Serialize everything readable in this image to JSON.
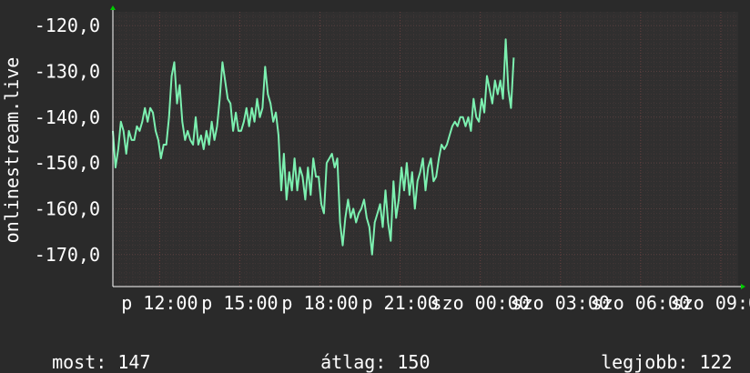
{
  "chart_data": {
    "type": "line",
    "ylabel": "onlinestream.live",
    "ylim": [
      -177,
      -117
    ],
    "yticks": [
      -120,
      -130,
      -140,
      -150,
      -160,
      -170
    ],
    "ytick_labels": [
      "-120,0",
      "-130,0",
      "-140,0",
      "-150,0",
      "-160,0",
      "-170,0"
    ],
    "xlim": [
      0,
      23.4
    ],
    "xticks": [
      {
        "x": 1.75,
        "label": "p 12:00"
      },
      {
        "x": 4.75,
        "label": "p 15:00"
      },
      {
        "x": 7.75,
        "label": "p 18:00"
      },
      {
        "x": 10.75,
        "label": "p 21:00"
      },
      {
        "x": 13.75,
        "label": "szo 00:00"
      },
      {
        "x": 16.75,
        "label": "szo 03:00"
      },
      {
        "x": 19.75,
        "label": "szo 06:00"
      },
      {
        "x": 22.75,
        "label": "szo 09:00"
      }
    ],
    "grid": true,
    "colors": {
      "background": "#2a2a2a",
      "plot_background": "#302f2f",
      "grid": "#4a3a3a",
      "line": "#7cf0b0",
      "text": "#ffffff",
      "arrow": "#00cc00"
    },
    "series": [
      {
        "values": [
          [
            0.0,
            -143
          ],
          [
            0.1,
            -151
          ],
          [
            0.2,
            -147
          ],
          [
            0.3,
            -141
          ],
          [
            0.4,
            -143
          ],
          [
            0.5,
            -148
          ],
          [
            0.6,
            -143
          ],
          [
            0.7,
            -145
          ],
          [
            0.8,
            -145
          ],
          [
            0.9,
            -142
          ],
          [
            1.0,
            -143
          ],
          [
            1.1,
            -141
          ],
          [
            1.2,
            -138
          ],
          [
            1.3,
            -141
          ],
          [
            1.4,
            -138
          ],
          [
            1.5,
            -139
          ],
          [
            1.6,
            -143
          ],
          [
            1.7,
            -145
          ],
          [
            1.8,
            -149
          ],
          [
            1.9,
            -146
          ],
          [
            2.0,
            -146
          ],
          [
            2.1,
            -140
          ],
          [
            2.2,
            -131
          ],
          [
            2.3,
            -128
          ],
          [
            2.4,
            -137
          ],
          [
            2.5,
            -133
          ],
          [
            2.6,
            -141
          ],
          [
            2.7,
            -145
          ],
          [
            2.8,
            -143
          ],
          [
            2.9,
            -145
          ],
          [
            3.0,
            -146
          ],
          [
            3.1,
            -140
          ],
          [
            3.2,
            -146
          ],
          [
            3.3,
            -144
          ],
          [
            3.4,
            -147
          ],
          [
            3.5,
            -143
          ],
          [
            3.6,
            -146
          ],
          [
            3.7,
            -141
          ],
          [
            3.8,
            -145
          ],
          [
            3.9,
            -142
          ],
          [
            4.0,
            -136
          ],
          [
            4.1,
            -128
          ],
          [
            4.2,
            -132
          ],
          [
            4.3,
            -136
          ],
          [
            4.4,
            -137
          ],
          [
            4.5,
            -143
          ],
          [
            4.6,
            -139
          ],
          [
            4.7,
            -143
          ],
          [
            4.8,
            -143
          ],
          [
            4.9,
            -141
          ],
          [
            5.0,
            -138
          ],
          [
            5.1,
            -142
          ],
          [
            5.2,
            -138
          ],
          [
            5.3,
            -141
          ],
          [
            5.4,
            -136
          ],
          [
            5.5,
            -140
          ],
          [
            5.6,
            -138
          ],
          [
            5.7,
            -129
          ],
          [
            5.8,
            -135
          ],
          [
            5.9,
            -137
          ],
          [
            6.0,
            -141
          ],
          [
            6.1,
            -139
          ],
          [
            6.2,
            -144
          ],
          [
            6.3,
            -156
          ],
          [
            6.4,
            -148
          ],
          [
            6.5,
            -158
          ],
          [
            6.6,
            -152
          ],
          [
            6.7,
            -156
          ],
          [
            6.8,
            -149
          ],
          [
            6.9,
            -156
          ],
          [
            7.0,
            -151
          ],
          [
            7.1,
            -153
          ],
          [
            7.2,
            -158
          ],
          [
            7.3,
            -151
          ],
          [
            7.4,
            -157
          ],
          [
            7.5,
            -149
          ],
          [
            7.6,
            -153
          ],
          [
            7.7,
            -153
          ],
          [
            7.8,
            -159
          ],
          [
            7.9,
            -161
          ],
          [
            8.0,
            -150
          ],
          [
            8.1,
            -149
          ],
          [
            8.2,
            -148
          ],
          [
            8.3,
            -151
          ],
          [
            8.4,
            -149
          ],
          [
            8.5,
            -163
          ],
          [
            8.6,
            -168
          ],
          [
            8.7,
            -162
          ],
          [
            8.8,
            -158
          ],
          [
            8.9,
            -162
          ],
          [
            9.0,
            -160
          ],
          [
            9.1,
            -163
          ],
          [
            9.2,
            -161
          ],
          [
            9.3,
            -160
          ],
          [
            9.4,
            -158
          ],
          [
            9.5,
            -162
          ],
          [
            9.6,
            -164
          ],
          [
            9.7,
            -170
          ],
          [
            9.8,
            -163
          ],
          [
            9.9,
            -161
          ],
          [
            10.0,
            -159
          ],
          [
            10.1,
            -164
          ],
          [
            10.2,
            -156
          ],
          [
            10.3,
            -163
          ],
          [
            10.4,
            -167
          ],
          [
            10.5,
            -154
          ],
          [
            10.6,
            -162
          ],
          [
            10.7,
            -158
          ],
          [
            10.8,
            -151
          ],
          [
            10.9,
            -156
          ],
          [
            11.0,
            -150
          ],
          [
            11.1,
            -157
          ],
          [
            11.2,
            -152
          ],
          [
            11.3,
            -160
          ],
          [
            11.4,
            -154
          ],
          [
            11.5,
            -152
          ],
          [
            11.6,
            -149
          ],
          [
            11.7,
            -156
          ],
          [
            11.8,
            -151
          ],
          [
            11.9,
            -149
          ],
          [
            12.0,
            -154
          ],
          [
            12.1,
            -153
          ],
          [
            12.2,
            -149
          ],
          [
            12.3,
            -146
          ],
          [
            12.4,
            -147
          ],
          [
            12.5,
            -146
          ],
          [
            12.6,
            -144
          ],
          [
            12.7,
            -142
          ],
          [
            12.8,
            -141
          ],
          [
            12.9,
            -142
          ],
          [
            13.0,
            -140
          ],
          [
            13.1,
            -140
          ],
          [
            13.2,
            -142
          ],
          [
            13.3,
            -140
          ],
          [
            13.4,
            -143
          ],
          [
            13.5,
            -136
          ],
          [
            13.6,
            -140
          ],
          [
            13.7,
            -141
          ],
          [
            13.8,
            -136
          ],
          [
            13.9,
            -139
          ],
          [
            14.0,
            -131
          ],
          [
            14.1,
            -134
          ],
          [
            14.2,
            -137
          ],
          [
            14.3,
            -132
          ],
          [
            14.4,
            -135
          ],
          [
            14.5,
            -132
          ],
          [
            14.6,
            -136
          ],
          [
            14.7,
            -123
          ],
          [
            14.8,
            -134
          ],
          [
            14.9,
            -138
          ],
          [
            15.0,
            -127
          ]
        ]
      }
    ]
  },
  "legend": {
    "now_label": "most:",
    "now_value": "147",
    "avg_label": "átlag:",
    "avg_value": "150",
    "best_label": "legjobb:",
    "best_value": "122"
  }
}
